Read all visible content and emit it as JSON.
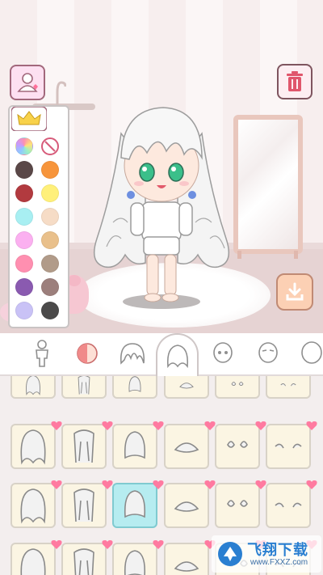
{
  "scene": {
    "buttons": {
      "profile": "profile-icon",
      "trash": "trash-icon",
      "download": "download-icon",
      "crown": "crown-icon"
    }
  },
  "palette": {
    "colors": [
      "rainbow",
      "none",
      "#5a4848",
      "#f7953b",
      "#b23a3f",
      "#fff07a",
      "#a8eff2",
      "#f6dcc6",
      "#fbb0f0",
      "#e9c08b",
      "#ff8fb0",
      "#b19b89",
      "#8a5ab0",
      "#9c7f7c",
      "#c9c2f6",
      "#4b4a4a"
    ]
  },
  "tabs": [
    {
      "name": "body",
      "icon": "body-icon"
    },
    {
      "name": "skin",
      "icon": "skin-icon"
    },
    {
      "name": "front-hair",
      "icon": "front-hair-icon"
    },
    {
      "name": "back-hair",
      "icon": "back-hair-icon",
      "selected": true
    },
    {
      "name": "face",
      "icon": "face-icon"
    },
    {
      "name": "eyebrows",
      "icon": "eyebrows-icon"
    },
    {
      "name": "head",
      "icon": "head-icon"
    }
  ],
  "grid": {
    "selected_index": 8,
    "rows": 3
  },
  "watermark": {
    "title": "飞翔下载",
    "url": "www.FXXZ.com"
  }
}
